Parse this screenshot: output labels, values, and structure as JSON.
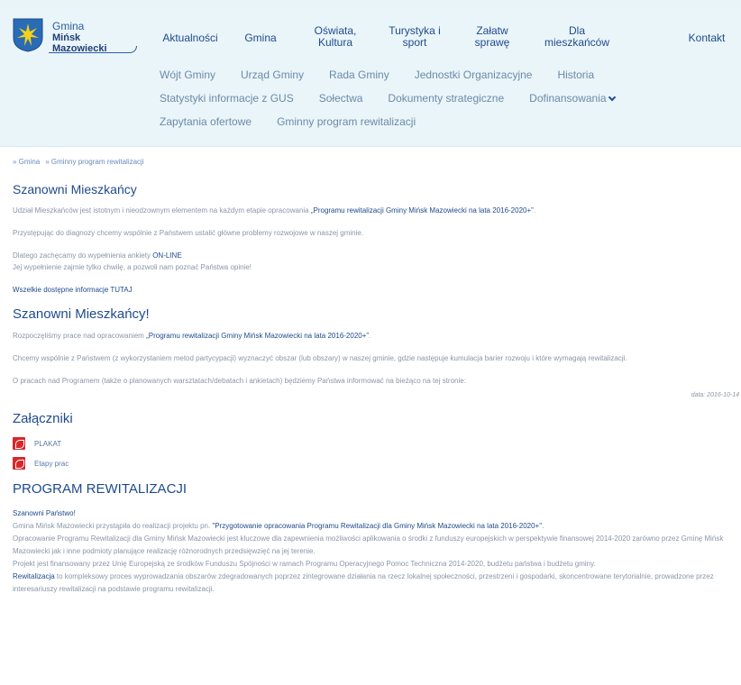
{
  "logo": {
    "line1": "Gmina",
    "line2": "Mińsk Mazowiecki"
  },
  "nav": [
    {
      "label": "Aktualności",
      "name": "nav-aktualnosci"
    },
    {
      "label": "Gmina",
      "name": "nav-gmina"
    },
    {
      "label": "Oświata,\nKultura",
      "name": "nav-oswiata"
    },
    {
      "label": "Turystyka i\nsport",
      "name": "nav-turystyka"
    },
    {
      "label": "Załatw\nsprawę",
      "name": "nav-zalatw"
    },
    {
      "label": "Dla\nmieszkańców",
      "name": "nav-dla-mieszkancow"
    },
    {
      "label": "Kontakt",
      "name": "nav-kontakt"
    }
  ],
  "subnav": {
    "row1": [
      "Wójt Gminy",
      "Urząd Gminy",
      "Rada Gminy",
      "Jednostki Organizacyjne",
      "Historia"
    ],
    "row2": [
      "Statystyki informacje z GUS",
      "Sołectwa",
      "Dokumenty strategiczne",
      "Dofinansowania"
    ],
    "row3": [
      "Zapytania ofertowe",
      "Gminny program rewitalizacji"
    ]
  },
  "breadcrumb": [
    "» Gmina",
    "» Gminny program rewitalizacji"
  ],
  "section1": {
    "title": "Szanowni Mieszkańcy",
    "p1_pre": "Udział Mieszkańców jest istotnym i nieodzownym elementem na każdym etapie opracowania ",
    "p1_bold": "„Programu rewitalizacji Gminy Mińsk Mazowiecki na lata 2016-2020+”",
    "p1_post": ".",
    "p2": "Przystępując do diagnozy chcemy wspólnie z Państwem ustalić główne problemy rozwojowe w naszej gminie.",
    "p3_pre": "Dlatego zachęcamy do wypełnienia ankiety ",
    "p3_link": "ON-LINE",
    "p3_line2": "Jej wypełnienie zajmie tylko chwilę, a pozwoli nam poznać Państwa opinie!",
    "p4": "Wszelkie dostępne informacje TUTAJ"
  },
  "section2": {
    "title": "Szanowni Mieszkańcy!",
    "p1_pre": "Rozpoczęliśmy prace nad opracowaniem ",
    "p1_bold": "„Programu rewitalizacji Gminy Mińsk Mazowiecki na lata 2016-2020+”",
    "p1_post": ".",
    "p2": "Chcemy wspólnie z Państwem (z wykorzystaniem metod partycypacji) wyznaczyć obszar (lub obszary) w naszej gminie, gdzie następuje kumulacja barier rozwoju i które wymagają rewitalizacji.",
    "p3": "O pracach nad Programem (także o planowanych warsztatach/debatach i ankietach)  będziemy Państwa informować na bieżąco  na tej stronie:",
    "date": "data: 2016-10-14"
  },
  "attachments": {
    "title": "Załączniki",
    "items": [
      "PLAKAT",
      "Etapy prac"
    ]
  },
  "program": {
    "title": "PROGRAM REWITALIZACJI",
    "greeting": "Szanowni Państwo!",
    "l1_pre": "Gmina Mińsk Mazowiecki przystąpiła do realizacji projektu pn. ",
    "l1_bold": "\"Przygotowanie opracowania Programu Rewitalizacji dla Gminy Mińsk Mazowiecki na lata 2016-2020+\"",
    "l1_post": ".",
    "l2": "Opracowanie Programu Rewitalizacji dla Gminy Mińsk Mazowiecki jest kluczowe dla zapewnienia możliwości aplikowania o środki z funduszy europejskich w perspektywie finansowej 2014-2020 zarówno przez Gminę Mińsk Mazowiecki jak i inne podmioty planujące realizację różnorodnych przedsięwzięć na jej terenie.",
    "l3": "Projekt jest finansowany przez Unię Europejską ze środków Funduszu Spójności w ramach Programu Operacyjnego Pomoc Techniczna 2014-2020, budżetu państwa i budżetu gminy.",
    "l4_bold": "Rewitalizacja",
    "l4_rest": " to kompleksowy proces wyprowadzania obszarów zdegradowanych poprzez zintegrowane działania na rzecz lokalnej społeczności, przestrzeni i gospodarki, skoncentrowane terytorialnie, prowadzone przez interesariuszy rewitalizacji na podstawie programu rewitalizacji."
  }
}
